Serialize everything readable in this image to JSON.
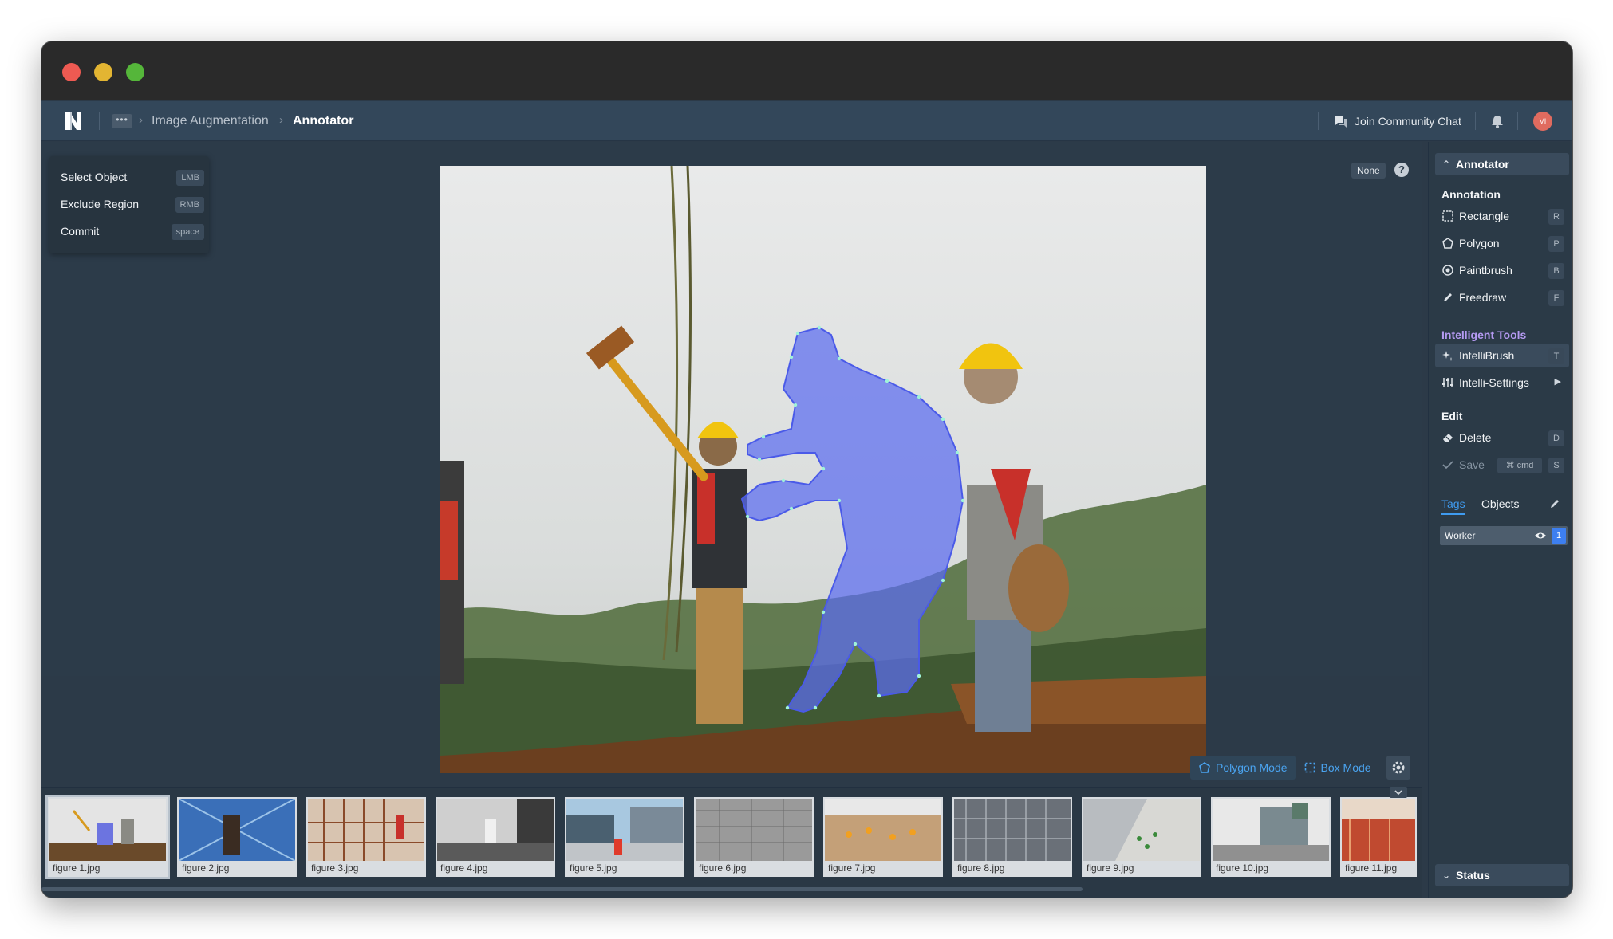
{
  "window": {
    "controls": [
      "close",
      "minimize",
      "zoom"
    ]
  },
  "nav": {
    "more_label": "•••",
    "breadcrumb": [
      "Image Augmentation",
      "Annotator"
    ],
    "community_label": "Join Community Chat",
    "avatar_initials": "VI"
  },
  "shortcuts": [
    {
      "label": "Select Object",
      "key": "LMB"
    },
    {
      "label": "Exclude Region",
      "key": "RMB"
    },
    {
      "label": "Commit",
      "key": "space"
    }
  ],
  "canvas": {
    "class_badge": "None",
    "help_symbol": "?",
    "modes": [
      {
        "label": "Polygon Mode",
        "icon": "polygon-icon",
        "active": true
      },
      {
        "label": "Box Mode",
        "icon": "box-icon",
        "active": false
      }
    ],
    "polygon_color": "#5b6cf0"
  },
  "filmstrip": [
    "figure 1.jpg",
    "figure 2.jpg",
    "figure 3.jpg",
    "figure 4.jpg",
    "figure 5.jpg",
    "figure 6.jpg",
    "figure 7.jpg",
    "figure 8.jpg",
    "figure 9.jpg",
    "figure 10.jpg",
    "figure 11.jpg"
  ],
  "panel": {
    "header": "Annotator",
    "annotation_title": "Annotation",
    "annotation_tools": [
      {
        "label": "Rectangle",
        "key": "R",
        "icon": "rectangle-icon"
      },
      {
        "label": "Polygon",
        "key": "P",
        "icon": "polygon-icon"
      },
      {
        "label": "Paintbrush",
        "key": "B",
        "icon": "paintbrush-icon"
      },
      {
        "label": "Freedraw",
        "key": "F",
        "icon": "pencil-icon"
      }
    ],
    "intelligent_title": "Intelligent Tools",
    "intellibrush": {
      "label": "IntelliBrush",
      "key": "T"
    },
    "intellisettings": {
      "label": "Intelli-Settings"
    },
    "edit_title": "Edit",
    "delete": {
      "label": "Delete",
      "key": "D"
    },
    "save": {
      "label": "Save",
      "cmd": "⌘ cmd",
      "key": "S"
    },
    "tabs": [
      "Tags",
      "Objects"
    ],
    "tags": [
      {
        "name": "Worker",
        "count": "1"
      }
    ],
    "status": "Status"
  },
  "colors": {
    "accent": "#3f9bf0",
    "intelligent": "#b59af2",
    "polygon": "#5b6cf0"
  }
}
